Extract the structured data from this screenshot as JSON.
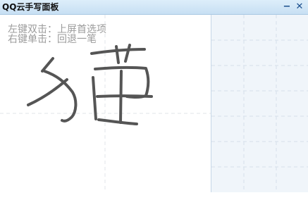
{
  "window": {
    "title": "QQ云手写面板",
    "minimize_icon": "minimize-icon",
    "close_icon": "close-icon",
    "minimize_glyph": "−",
    "close_glyph": "✕"
  },
  "canvas": {
    "hint_line_1": "左键双击：上屏首选项",
    "hint_line_2": "右键单击：回退一笔"
  },
  "candidates": {
    "items": []
  },
  "colors": {
    "titlebar": "#c7dff3",
    "ink": "#555555",
    "hint_text": "#9b9b9b",
    "grid": "#d6e0ea",
    "panel_bg": "#f0f5fa"
  }
}
